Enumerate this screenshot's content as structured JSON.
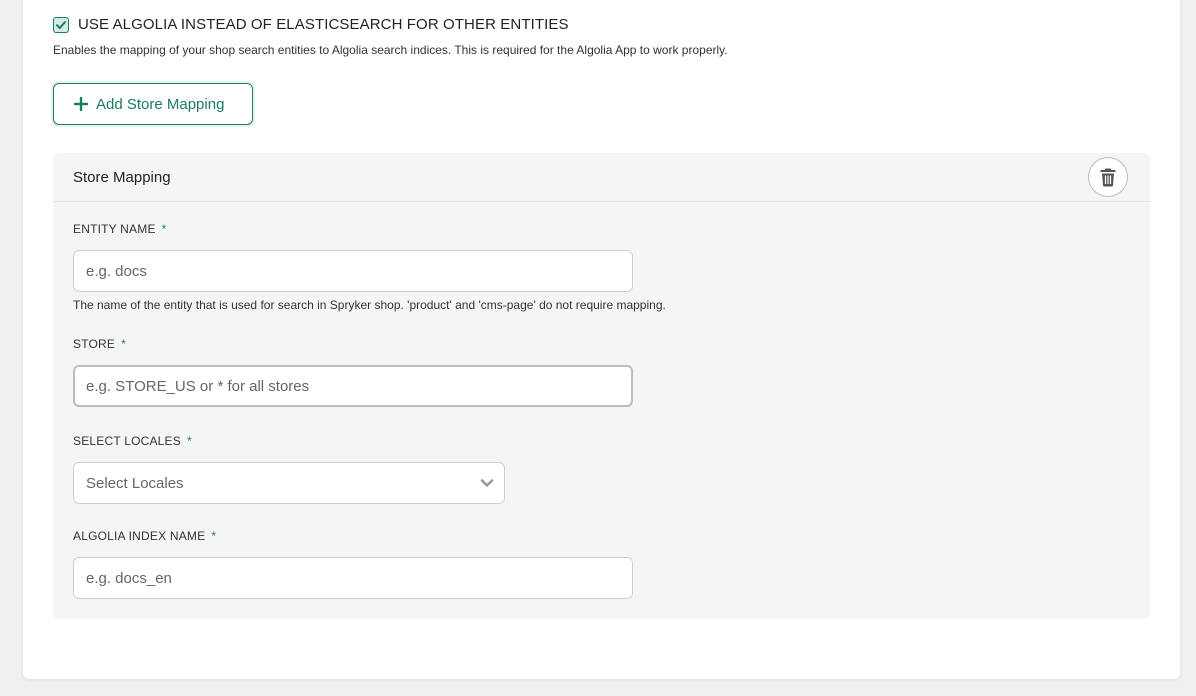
{
  "settings": {
    "use_algolia_checkbox": {
      "label": "USE ALGOLIA INSTEAD OF ELASTICSEARCH FOR OTHER ENTITIES",
      "checked": true,
      "help": "Enables the mapping of your shop search entities to Algolia search indices. This is required for the Algolia App to work properly."
    },
    "add_store_mapping_label": "Add Store Mapping"
  },
  "store_mapping": {
    "title": "Store Mapping",
    "entity_name": {
      "label": "ENTITY NAME",
      "required_mark": "*",
      "placeholder": "e.g. docs",
      "value": "",
      "help": "The name of the entity that is used for search in Spryker shop. 'product' and 'cms-page' do not require mapping."
    },
    "store": {
      "label": "STORE",
      "required_mark": "*",
      "placeholder": "e.g. STORE_US or * for all stores",
      "value": ""
    },
    "locales": {
      "label": "SELECT LOCALES",
      "required_mark": "*",
      "placeholder": "Select Locales"
    },
    "algolia_index_name": {
      "label": "ALGOLIA INDEX NAME",
      "required_mark": "*",
      "placeholder": "e.g. docs_en",
      "value": ""
    }
  },
  "colors": {
    "accent": "#1d7b64",
    "panel_bg": "#f5f5f5",
    "page_bg": "#f0f0f0"
  },
  "icons": {
    "checkbox": "check-icon",
    "add": "plus-icon",
    "delete": "trash-icon",
    "select": "chevron-down-icon"
  }
}
